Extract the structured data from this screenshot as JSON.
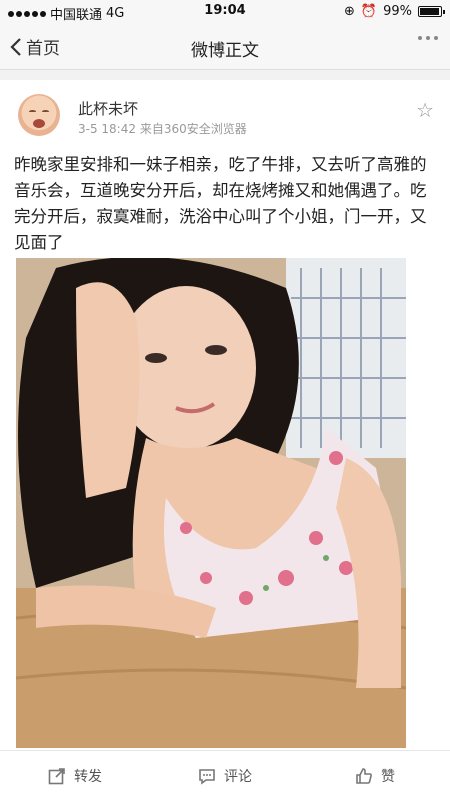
{
  "status_bar": {
    "carrier": "中国联通",
    "network": "4G",
    "time": "19:04",
    "battery": "99%"
  },
  "nav": {
    "back_label": "首页",
    "title": "微博正文"
  },
  "post": {
    "username": "此杯未坏",
    "time": "3-5 18:42",
    "source": "来自360安全浏览器",
    "text": "昨晚家里安排和一妹子相亲，吃了牛排，又去听了高雅的音乐会，互道晚安分开后，却在烧烤摊又和她偶遇了。吃完分开后，寂寞难耐，洗浴中心叫了个小姐，门一开，又见面了"
  },
  "actions": {
    "repost": "转发",
    "comment": "评论",
    "like": "赞"
  },
  "colors": {
    "accent_text": "#333333",
    "meta_text": "#999999",
    "background": "#f2f2f2"
  }
}
